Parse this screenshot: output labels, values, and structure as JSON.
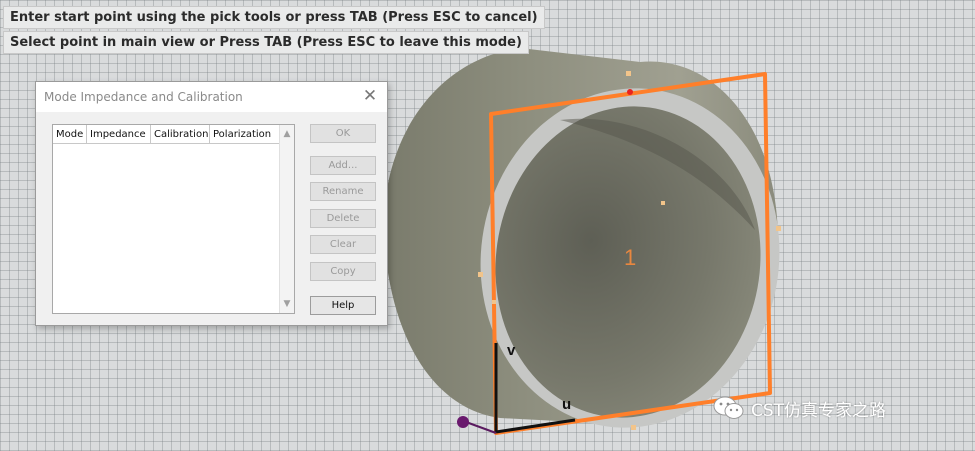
{
  "status_messages": [
    "Enter start point using the pick tools or press TAB (Press ESC to cancel)",
    "Select point in main view or Press TAB (Press ESC to leave this mode)"
  ],
  "dialog": {
    "title": "Mode Impedance and Calibration",
    "close_icon": "close-icon",
    "table_headers": [
      "Mode",
      "Impedance",
      "Calibration",
      "Polarization"
    ],
    "table_rows": [],
    "buttons": {
      "ok": "OK",
      "add": "Add...",
      "rename": "Rename",
      "delete": "Delete",
      "clear": "Clear",
      "copy": "Copy",
      "help": "Help"
    }
  },
  "viewport": {
    "port_label": "1",
    "axis_v": "v",
    "axis_u": "u",
    "colors": {
      "port_outline": "#ff7f2a",
      "cylinder_outer": "#8e8f80",
      "cylinder_inner": "#6f7063",
      "ring_face": "#c7c8c6",
      "axis_handle": "#6a1a6e",
      "marker_red": "#e8231f",
      "background_grid": "#d9dbdc"
    }
  },
  "watermark": {
    "text": "CST仿真专家之路",
    "icon": "wechat-icon"
  }
}
